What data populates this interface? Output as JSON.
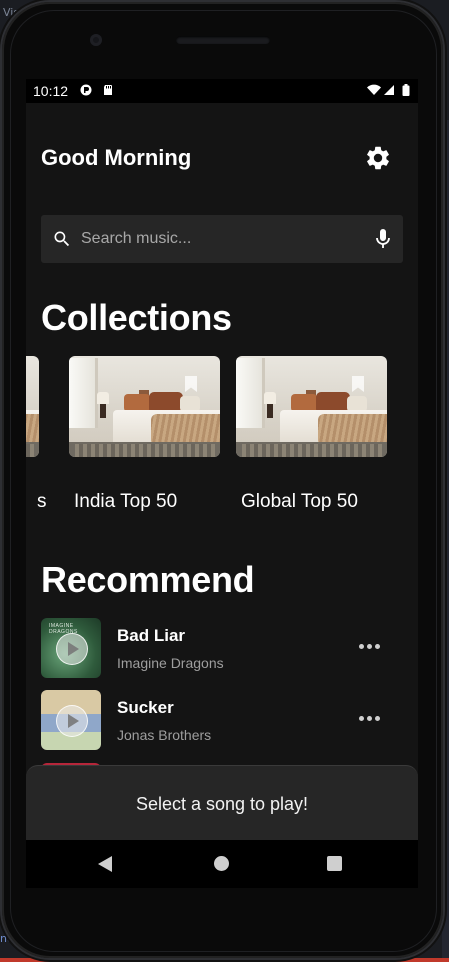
{
  "host": {
    "top_left_text": "Vis",
    "bottom_left_text": "nd"
  },
  "status_bar": {
    "time": "10:12",
    "icons": [
      "app-notification-icon",
      "sd-card-icon",
      "wifi-icon",
      "cell-signal-icon",
      "battery-icon"
    ]
  },
  "header": {
    "greeting": "Good Morning",
    "settings_icon": "gear-icon"
  },
  "search": {
    "placeholder": "Search music...",
    "search_icon": "search-icon",
    "mic_icon": "microphone-icon"
  },
  "collections": {
    "title": "Collections",
    "items": [
      {
        "label": "s",
        "bookmark_icon": "bookmark-icon"
      },
      {
        "label": "India Top 50",
        "bookmark_icon": "bookmark-icon"
      },
      {
        "label": "Global Top 50",
        "bookmark_icon": "bookmark-icon"
      }
    ]
  },
  "recommend": {
    "title": "Recommend",
    "songs": [
      {
        "title": "Bad Liar",
        "artist": "Imagine Dragons",
        "art_caption": "IMAGINE DRAGONS",
        "more_icon": "more-horizontal-icon"
      },
      {
        "title": "Sucker",
        "artist": "Jonas Brothers",
        "more_icon": "more-horizontal-icon"
      }
    ]
  },
  "player": {
    "message": "Select a song to play!"
  },
  "nav": {
    "back_icon": "back-triangle-icon",
    "home_icon": "home-circle-icon",
    "recents_icon": "recents-square-icon"
  },
  "colors": {
    "screen_bg": "#141414",
    "surface": "#262626",
    "text_primary": "#ffffff",
    "text_secondary": "#9e9e9e"
  }
}
